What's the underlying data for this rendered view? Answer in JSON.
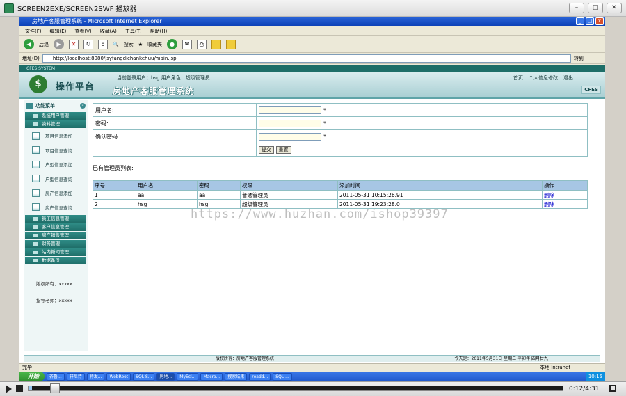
{
  "player": {
    "title": "SCREEN2EXE/SCREEN2SWF 播放器",
    "time": "0:12/4:31"
  },
  "browser": {
    "title": "房地产客服管理系统 - Microsoft Internet Explorer",
    "menu": [
      "文件(F)",
      "编辑(E)",
      "查看(V)",
      "收藏(A)",
      "工具(T)",
      "帮助(H)"
    ],
    "toolbar": {
      "back": "后退",
      "search": "搜索",
      "favorites": "收藏夹"
    },
    "address_label": "地址(D)",
    "address": "http://localhost:8080/jsyfangdichankehuu/main.jsp",
    "go": "转到",
    "status": "完毕",
    "zone": "本地 Intranet"
  },
  "app": {
    "top_strip": "CFES SYSTEM",
    "logo_text": "操作平台",
    "system_title": "房地产客服管理系统",
    "user_info": "当前登录用户：hsg  用户角色：超级管理员",
    "links": [
      "首页",
      "个人信息修改",
      "退出"
    ],
    "badge": "CFES",
    "menu_header": "功能菜单",
    "categories_top": [
      "系统用户管理",
      "资料管理"
    ],
    "subitems": [
      "项目信息添加",
      "项目信息查询",
      "户型信息添加",
      "户型信息查询",
      "房产信息添加",
      "房产信息查询"
    ],
    "categories_bottom": [
      "员工信息管理",
      "客户信息管理",
      "房产销售管理",
      "财务管理",
      "站内新闻管理",
      "数据备份"
    ],
    "copyright": "版权所有：xxxxx",
    "teacher": "指导老师：xxxxx",
    "footer_copyright": "版权所有：房地产客服管理系统",
    "footer_date": "今天是：2011年5月31日 星期二 辛卯年 四月廿九"
  },
  "form": {
    "username_label": "用户名:",
    "password_label": "密码:",
    "confirm_label": "确认密码:",
    "required_mark": "*",
    "submit": "提交",
    "reset": "重置"
  },
  "list": {
    "title": "已有管理员列表:",
    "headers": [
      "序号",
      "用户名",
      "密码",
      "权限",
      "添加时间",
      "操作"
    ],
    "rows": [
      [
        "1",
        "aa",
        "aa",
        "普通管理员",
        "2011-05-31 10:15:26.91",
        "删除"
      ],
      [
        "2",
        "hsg",
        "hsg",
        "超级管理员",
        "2011-05-31 19:23:28.0",
        "删除"
      ]
    ]
  },
  "taskbar": {
    "start": "开始",
    "tasks": [
      "齐鲁...",
      "轩尼诗",
      "特发...",
      "WebRoot",
      "SQL S...",
      "房地...",
      "MyEcl...",
      "Macro...",
      "搜索结果",
      "readd...",
      "SQL ..."
    ],
    "clock": "10:15"
  },
  "watermark": "https://www.huzhan.com/ishop39397"
}
